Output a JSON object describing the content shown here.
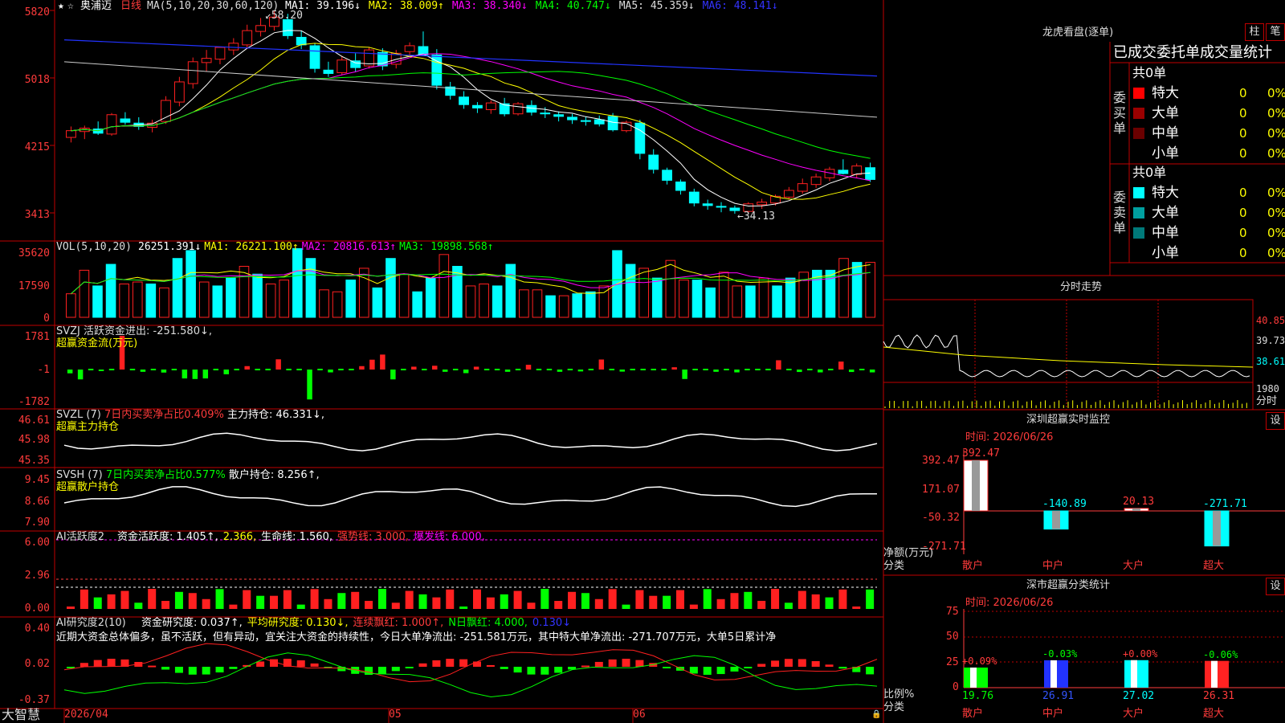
{
  "stock": {
    "name": "奥浦迈",
    "period": "日线",
    "ma_label": "MA(5,10,20,30,60,120)",
    "ma_items": [
      {
        "t": "MA1: 39.196↓",
        "c": "#ffffff"
      },
      {
        "t": "MA2: 38.009↑",
        "c": "#ffff00"
      },
      {
        "t": "MA3: 38.340↓",
        "c": "#ff00ff"
      },
      {
        "t": "MA4: 40.747↓",
        "c": "#00ff00"
      },
      {
        "t": "MA5: 45.359↓",
        "c": "#dddddd"
      },
      {
        "t": "MA6: 48.141↓",
        "c": "#3333ff"
      }
    ]
  },
  "axes": {
    "price": [
      "5820",
      "5018",
      "4215",
      "3413"
    ],
    "price_high": "58.20",
    "price_low": "34.13",
    "vol": [
      "35620",
      "17590",
      "0"
    ],
    "svzj": [
      "1781",
      "-1",
      "-1782"
    ],
    "svzl": [
      "46.61",
      "45.98",
      "45.35"
    ],
    "svsh": [
      "9.45",
      "8.66",
      "7.90"
    ],
    "ai1": [
      "6.00",
      "2.96",
      "0.00"
    ],
    "ai2": [
      "0.40",
      "0.02",
      "-0.37"
    ]
  },
  "panels": {
    "vol": {
      "head": "VOL(5,10,20)",
      "items": [
        {
          "t": "26251.391↓",
          "c": "#ffffff"
        },
        {
          "t": "MA1: 26221.100↑",
          "c": "#ffff00"
        },
        {
          "t": "MA2: 20816.613↑",
          "c": "#ff00ff"
        },
        {
          "t": "MA3: 19898.568↑",
          "c": "#00ff00"
        }
      ]
    },
    "svzj": {
      "head": "SVZJ  活跃资金进出: -251.580↓,",
      "sub": "超赢资金流(万元)"
    },
    "svzl": {
      "head": "SVZL (7)",
      "pct": "7日内买卖净占比0.409%",
      "main": "主力持仓: 46.331↓,",
      "sub": "超赢主力持仓"
    },
    "svsh": {
      "head": "SVSH (7)",
      "pct": "7日内买卖净占比0.577%",
      "main": "散户持仓: 8.256↑,",
      "sub": "超赢散户持仓"
    },
    "ai1": {
      "head": "AI活跃度2",
      "items": [
        {
          "t": "资金活跃度: 1.405↑,",
          "c": "#ffffff"
        },
        {
          "t": "2.366,",
          "c": "#ffff00"
        },
        {
          "t": "生命线: 1.560,",
          "c": "#ffffff"
        },
        {
          "t": "强势线: 3.000,",
          "c": "#ff3b3b"
        },
        {
          "t": "爆发线: 6.000,",
          "c": "#ff00ff"
        }
      ]
    },
    "ai2": {
      "head": "AI研究度2(10)",
      "items": [
        {
          "t": "资金研究度: 0.037↑,",
          "c": "#ffffff"
        },
        {
          "t": "平均研究度: 0.130↓,",
          "c": "#ffff00"
        },
        {
          "t": "连续飘红: 1.000↑,",
          "c": "#ff3b3b"
        },
        {
          "t": "N日飘红: 4.000,",
          "c": "#00ff00"
        },
        {
          "t": "0.130↓",
          "c": "#3333ff"
        }
      ],
      "note": "近期大资金总体偏多，虽不活跃，但有异动，宜关注大资金的持续性，今日大单净流出: -251.581万元，其中特大单净流出: -271.707万元，大单5日累计净"
    }
  },
  "dates": [
    "2026/04",
    "05",
    "06"
  ],
  "app_name": "大智慧",
  "right": {
    "lhb_title": "龙虎看盘(逐单)",
    "tab1": "柱",
    "tab2": "笔",
    "stats_title": "已成交委托单成交量统计",
    "buy": {
      "side": "委买单",
      "total": "共0单",
      "rows": [
        {
          "l": "特大",
          "v": "0",
          "p": "0%",
          "c": "#ff0000"
        },
        {
          "l": "大单",
          "v": "0",
          "p": "0%",
          "c": "#9a0000"
        },
        {
          "l": "中单",
          "v": "0",
          "p": "0%",
          "c": "#6a0000"
        },
        {
          "l": "小单",
          "v": "0",
          "p": "0%",
          "c": ""
        }
      ]
    },
    "sell": {
      "side": "委卖单",
      "total": "共0单",
      "rows": [
        {
          "l": "特大",
          "v": "0",
          "p": "0%",
          "c": "#00ffff"
        },
        {
          "l": "大单",
          "v": "0",
          "p": "0%",
          "c": "#00a0a0"
        },
        {
          "l": "中单",
          "v": "0",
          "p": "0%",
          "c": "#007a7a"
        },
        {
          "l": "小单",
          "v": "0",
          "p": "0%",
          "c": ""
        }
      ]
    },
    "fs_title": "分时走势",
    "fs_prices": [
      "40.85",
      "39.73",
      "38.61"
    ],
    "fs_vol": "1980",
    "fs_unit": "分时",
    "sz_title": "深圳超赢实时监控",
    "sz_time": "时间: 2026/06/26",
    "sz_axis": [
      "392.47",
      "171.07",
      "-50.32",
      "-271.71"
    ],
    "sz_unit": "净额(万元)",
    "sz_cat_label": "分类",
    "sz_bars": [
      {
        "name": "散户",
        "value": 392.47,
        "label": "392.47",
        "lc": "#ff3b3b"
      },
      {
        "name": "中户",
        "value": -140.89,
        "label": "-140.89",
        "lc": "#00ffff"
      },
      {
        "name": "大户",
        "value": 20.13,
        "label": "20.13",
        "lc": "#ff3b3b"
      },
      {
        "name": "超大",
        "value": -271.71,
        "label": "-271.71",
        "lc": "#00ffff"
      }
    ],
    "setting": "设",
    "cls_title": "深市超赢分类统计",
    "cls_time": "时间: 2026/06/26",
    "cls_axis": [
      "75",
      "50",
      "25",
      "0"
    ],
    "cls_unit": "比例%",
    "cls_cat_label": "分类",
    "cls_bars": [
      {
        "name": "散户",
        "value": 19.76,
        "label": "19.76",
        "chg": "+0.09%",
        "cc": "#ff3b3b",
        "fill": "#00ff00",
        "nc": "#00ff00"
      },
      {
        "name": "中户",
        "value": 26.91,
        "label": "26.91",
        "chg": "-0.03%",
        "cc": "#00ff00",
        "fill": "#2233ff",
        "nc": "#3355ff"
      },
      {
        "name": "大户",
        "value": 27.02,
        "label": "27.02",
        "chg": "+0.00%",
        "cc": "#ff3b3b",
        "fill": "#00ffff",
        "nc": "#00ffff"
      },
      {
        "name": "超大",
        "value": 26.31,
        "label": "26.31",
        "chg": "-0.06%",
        "cc": "#00ff00",
        "fill": "#ff2222",
        "nc": "#ff3b3b"
      }
    ]
  },
  "chart_data": [
    {
      "type": "candlestick",
      "title": "奥浦迈 日线",
      "ylim": [
        34.13,
        58.2
      ],
      "ohlc": [
        [
          43.2,
          44.5,
          42.6,
          44.0
        ],
        [
          43.9,
          44.6,
          43.0,
          44.3
        ],
        [
          44.2,
          45.1,
          43.5,
          43.7
        ],
        [
          43.6,
          46.1,
          43.4,
          45.9
        ],
        [
          45.4,
          46.2,
          44.7,
          45.0
        ],
        [
          44.9,
          45.6,
          44.1,
          44.5
        ],
        [
          44.4,
          45.3,
          43.8,
          44.9
        ],
        [
          45.1,
          48.1,
          44.8,
          47.6
        ],
        [
          47.4,
          50.4,
          46.9,
          49.8
        ],
        [
          49.6,
          52.7,
          49.0,
          52.2
        ],
        [
          52.1,
          53.6,
          51.0,
          52.6
        ],
        [
          52.5,
          54.0,
          51.9,
          53.9
        ],
        [
          53.6,
          55.0,
          53.0,
          54.4
        ],
        [
          54.2,
          56.6,
          53.7,
          55.9
        ],
        [
          55.8,
          57.4,
          55.2,
          56.5
        ],
        [
          56.4,
          58.2,
          55.9,
          57.5
        ],
        [
          57.2,
          57.9,
          54.9,
          55.3
        ],
        [
          55.1,
          55.9,
          53.7,
          54.2
        ],
        [
          54.1,
          54.4,
          50.9,
          51.4
        ],
        [
          51.2,
          52.2,
          50.4,
          50.8
        ],
        [
          50.9,
          52.9,
          50.6,
          52.4
        ],
        [
          52.3,
          53.2,
          51.0,
          51.5
        ],
        [
          51.7,
          53.9,
          51.4,
          53.6
        ],
        [
          53.3,
          53.8,
          51.2,
          51.7
        ],
        [
          51.9,
          53.6,
          51.4,
          53.2
        ],
        [
          53.4,
          54.5,
          52.8,
          54.1
        ],
        [
          54.0,
          55.8,
          53.6,
          53.0
        ],
        [
          53.0,
          53.7,
          48.9,
          49.4
        ],
        [
          49.2,
          49.8,
          47.7,
          48.2
        ],
        [
          48.0,
          48.7,
          46.6,
          47.1
        ],
        [
          47.0,
          47.4,
          46.1,
          46.7
        ],
        [
          46.5,
          47.6,
          46.0,
          47.3
        ],
        [
          47.2,
          47.9,
          45.7,
          46.0
        ],
        [
          46.0,
          47.4,
          45.8,
          47.2
        ],
        [
          47.0,
          47.6,
          45.8,
          46.2
        ],
        [
          46.1,
          46.8,
          45.5,
          46.0
        ],
        [
          45.9,
          46.3,
          45.1,
          45.7
        ],
        [
          45.6,
          46.0,
          44.8,
          45.3
        ],
        [
          45.2,
          45.7,
          44.6,
          45.1
        ],
        [
          45.3,
          45.8,
          44.5,
          44.8
        ],
        [
          45.7,
          46.1,
          43.9,
          44.1
        ],
        [
          44.0,
          45.2,
          43.8,
          45.0
        ],
        [
          44.9,
          45.3,
          40.6,
          41.3
        ],
        [
          41.1,
          41.8,
          38.9,
          39.4
        ],
        [
          39.3,
          39.6,
          37.6,
          38.1
        ],
        [
          37.9,
          38.2,
          36.4,
          36.9
        ],
        [
          36.7,
          37.1,
          35.0,
          35.4
        ],
        [
          35.3,
          35.8,
          34.6,
          35.1
        ],
        [
          35.0,
          35.5,
          34.3,
          34.9
        ],
        [
          34.8,
          35.1,
          34.13,
          34.5
        ],
        [
          34.4,
          35.5,
          34.2,
          35.3
        ],
        [
          35.2,
          35.9,
          34.7,
          35.5
        ],
        [
          35.4,
          36.4,
          35.1,
          36.2
        ],
        [
          36.1,
          37.3,
          35.8,
          36.9
        ],
        [
          36.8,
          38.3,
          36.5,
          37.7
        ],
        [
          37.6,
          38.9,
          37.2,
          38.5
        ],
        [
          38.4,
          39.7,
          38.0,
          39.4
        ],
        [
          39.3,
          40.6,
          38.8,
          38.9
        ],
        [
          38.8,
          40.1,
          38.4,
          39.8
        ],
        [
          39.6,
          40.2,
          37.9,
          38.2
        ]
      ]
    },
    {
      "type": "bar",
      "title": "VOL(5,10,20)",
      "ylim": [
        0,
        35620
      ],
      "values": [
        12000,
        24000,
        16000,
        27000,
        17000,
        18000,
        17000,
        15000,
        30000,
        34000,
        18000,
        16000,
        20000,
        26000,
        22000,
        17000,
        19000,
        35000,
        30000,
        14000,
        13000,
        19000,
        25000,
        15000,
        30000,
        22000,
        13000,
        20000,
        32000,
        26000,
        16000,
        17000,
        16000,
        27000,
        14000,
        14000,
        11000,
        11000,
        12000,
        13000,
        16000,
        34000,
        27000,
        25000,
        20000,
        29000,
        19000,
        19000,
        15000,
        23000,
        16000,
        16000,
        20000,
        16000,
        20000,
        23000,
        24000,
        24000,
        30000,
        28000,
        28000
      ]
    },
    {
      "type": "bar",
      "title": "SVZJ 活跃资金进出",
      "ylim": [
        -1782,
        1781
      ],
      "values": [
        -200,
        -520,
        0,
        -80,
        0,
        1780,
        0,
        -120,
        0,
        -160,
        0,
        -470,
        -500,
        -470,
        0,
        -250,
        0,
        180,
        0,
        0,
        540,
        0,
        0,
        -1580,
        0,
        -150,
        0,
        0,
        180,
        520,
        790,
        -520,
        0,
        150,
        0,
        200,
        -120,
        0,
        -190,
        150,
        0,
        0,
        -120,
        0,
        250,
        0,
        0,
        -120,
        0,
        -100,
        0,
        530,
        0,
        -110,
        0,
        0,
        0,
        0,
        120,
        -500,
        0,
        0,
        -120,
        0,
        -150,
        0,
        0,
        0,
        490,
        0,
        -130,
        0,
        -150,
        0,
        420,
        -130,
        0,
        -150
      ]
    }
  ]
}
